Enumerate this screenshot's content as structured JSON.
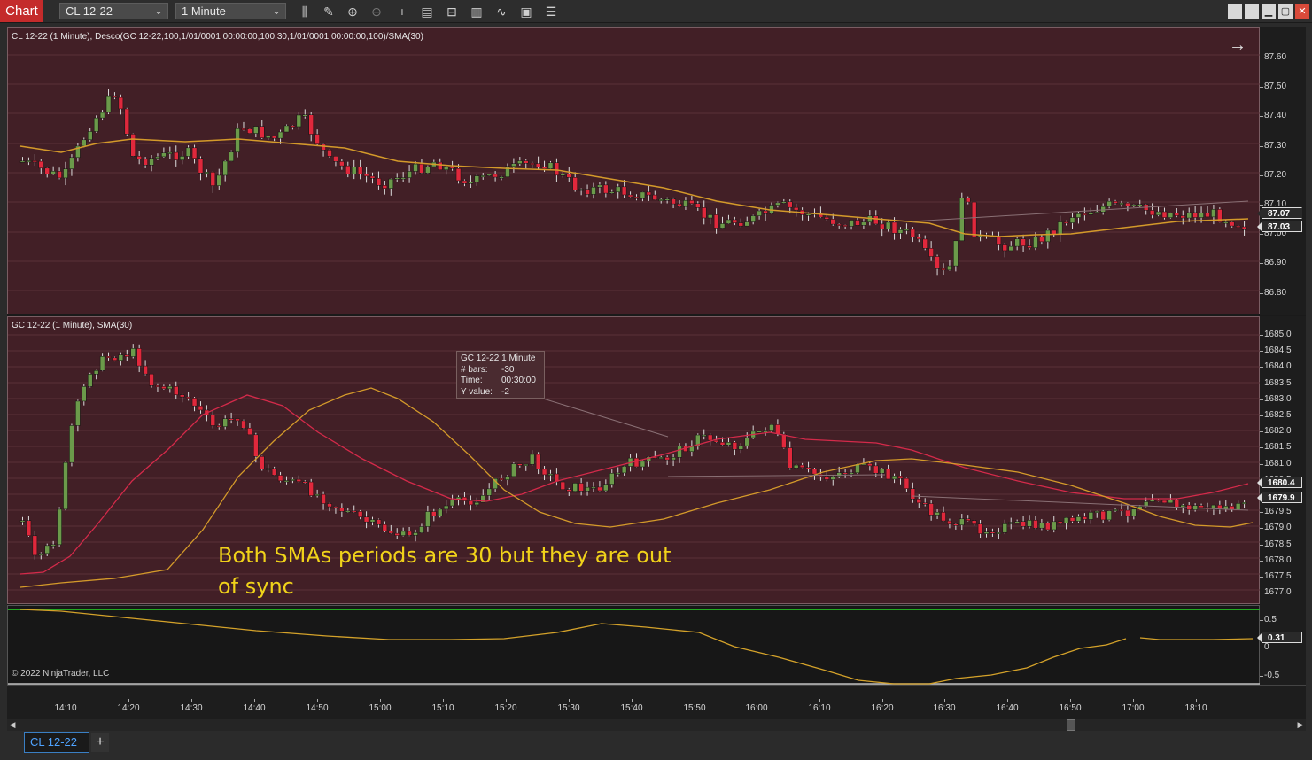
{
  "toolbar": {
    "chart_tab": "Chart",
    "instrument": "CL 12-22",
    "interval": "1 Minute",
    "icons": [
      "bar-type-icon",
      "drawing-tool-icon",
      "zoom-in-icon",
      "zoom-out-icon",
      "crosshair-icon",
      "data-box-icon",
      "properties-icon",
      "indicators-icon",
      "strategies-icon",
      "templates-icon",
      "menu-icon"
    ],
    "window_buttons": {
      "minimize": "▁",
      "maximize": "▢",
      "restore": "❐",
      "close": "✕"
    }
  },
  "panel1": {
    "label": "CL 12-22 (1 Minute), Desco(GC 12-22,100,1/01/0001 00:00:00,100,30,1/01/0001 00:00:00,100)/SMA(30)",
    "yticks": [
      "87.60",
      "87.50",
      "87.40",
      "87.30",
      "87.20",
      "87.10",
      "87.00",
      "86.90",
      "86.80"
    ],
    "price_badges": [
      {
        "value": "87.07",
        "color": "#2a2a2a"
      },
      {
        "value": "87.03",
        "color": "#2a2a2a"
      }
    ]
  },
  "panel2": {
    "label": "GC 12-22 (1 Minute), SMA(30)",
    "yticks": [
      "1685.0",
      "1684.5",
      "1684.0",
      "1683.5",
      "1683.0",
      "1682.5",
      "1682.0",
      "1681.5",
      "1681.0",
      "1680.5",
      "1680.0",
      "1679.5",
      "1679.0",
      "1678.5",
      "1678.0",
      "1677.5",
      "1677.0"
    ],
    "price_badges": [
      {
        "value": "1680.4",
        "color": "#2a2a2a"
      },
      {
        "value": "1679.9",
        "color": "#2a2a2a"
      }
    ],
    "annotation": "Both SMAs periods are 30 but they are out of sync",
    "tooltip": {
      "title": "GC 12-22 1 Minute",
      "rows": [
        {
          "k": "# bars:",
          "v": "-30"
        },
        {
          "k": "Time:",
          "v": "00:30:00"
        },
        {
          "k": "Y value:",
          "v": "-2"
        }
      ]
    }
  },
  "panel3": {
    "yticks": [
      "0.5",
      "0",
      "-0.5"
    ],
    "price_badge": "0.31",
    "copyright": "© 2022 NinjaTrader, LLC"
  },
  "xaxis": {
    "ticks": [
      "14:10",
      "14:20",
      "14:30",
      "14:40",
      "14:50",
      "15:00",
      "15:10",
      "15:20",
      "15:30",
      "15:40",
      "15:50",
      "16:00",
      "16:10",
      "16:20",
      "16:30",
      "16:40",
      "16:50",
      "17:00",
      "18:10"
    ]
  },
  "tabs": {
    "instrument_tab": "CL 12-22",
    "add_tab": "+"
  },
  "colors": {
    "panel_bg": "#421f26",
    "up_candle": "#6b9a4a",
    "down_candle": "#e0283c",
    "sma_orange": "#d49a2a",
    "sma_red": "#d42a4a",
    "correlation_line": "#d4a22a",
    "green_level": "#22aa22"
  }
}
